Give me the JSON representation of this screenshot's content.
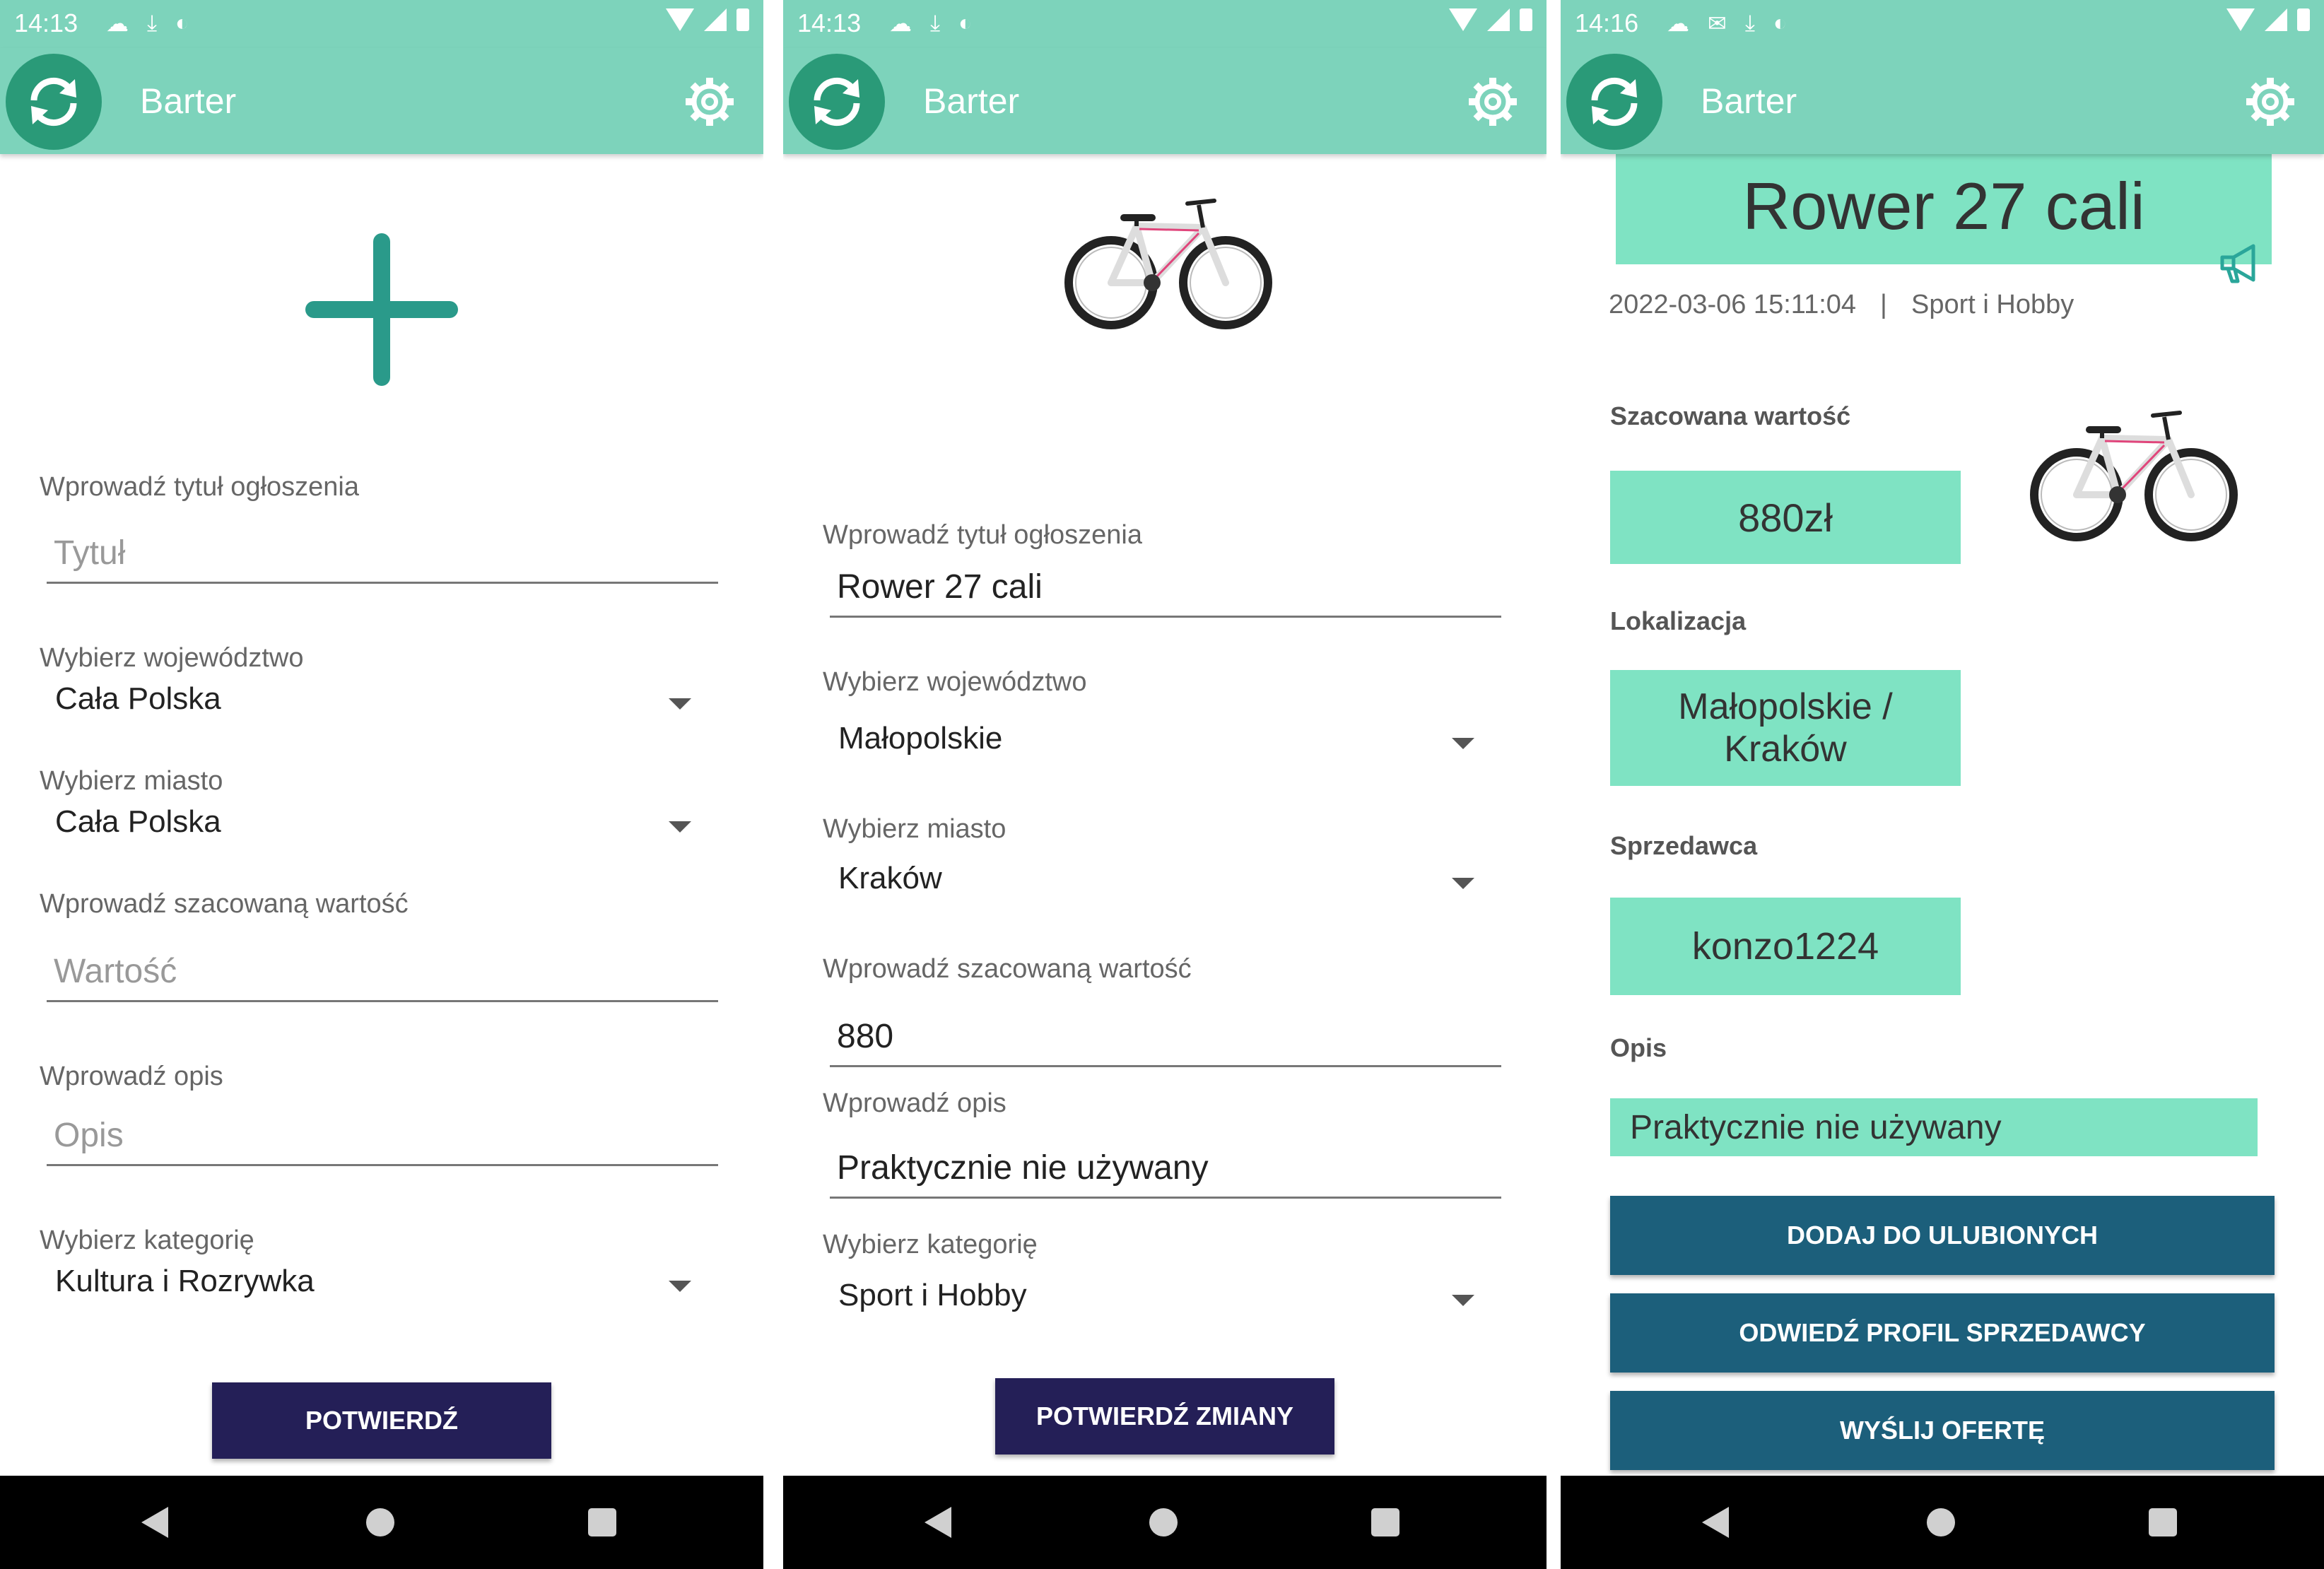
{
  "app": {
    "title": "Barter",
    "accent": "#7dd3bb",
    "logo_color": "#2a9a78"
  },
  "screens": [
    {
      "status": {
        "time": "14:13",
        "icons": [
          "cloud-icon",
          "download-done-icon",
          "pause-circle-icon"
        ]
      },
      "add_image_icon": "plus-icon",
      "title_label": "Wprowadź tytuł ogłoszenia",
      "title_placeholder": "Tytuł",
      "region_label": "Wybierz województwo",
      "region_value": "Cała Polska",
      "city_label": "Wybierz miasto",
      "city_value": "Cała Polska",
      "value_label": "Wprowadź szacowaną wartość",
      "value_placeholder": "Wartość",
      "desc_label": "Wprowadź opis",
      "desc_placeholder": "Opis",
      "category_label": "Wybierz kategorię",
      "category_value": "Kultura i Rozrywka",
      "confirm_button": "POTWIERDŹ"
    },
    {
      "status": {
        "time": "14:13",
        "icons": [
          "cloud-icon",
          "download-done-icon",
          "pause-circle-icon"
        ]
      },
      "title_label": "Wprowadź tytuł ogłoszenia",
      "title_value": "Rower 27 cali",
      "region_label": "Wybierz województwo",
      "region_value": "Małopolskie",
      "city_label": "Wybierz miasto",
      "city_value": "Kraków",
      "value_label": "Wprowadź szacowaną wartość",
      "value_value": "880",
      "desc_label": "Wprowadź opis",
      "desc_value": "Praktycznie nie używany",
      "category_label": "Wybierz kategorię",
      "category_value": "Sport i Hobby",
      "confirm_button": "POTWIERDŹ ZMIANY"
    },
    {
      "status": {
        "time": "14:16",
        "icons": [
          "cloud-icon",
          "mail-icon",
          "download-done-icon",
          "pause-circle-icon"
        ]
      },
      "listing_title": "Rower 27 cali",
      "date": "2022-03-06 15:11:04",
      "separator": "|",
      "category": "Sport i Hobby",
      "value_label": "Szacowana wartość",
      "value": "880zł",
      "location_label": "Lokalizacja",
      "location": "Małopolskie / Kraków",
      "seller_label": "Sprzedawca",
      "seller": "konzo1224",
      "desc_label": "Opis",
      "desc": "Praktycznie nie używany",
      "buttons": [
        "DODAJ DO ULUBIONYCH",
        "ODWIEDŹ PROFIL SPRZEDAWCY",
        "WYŚLIJ OFERTĘ"
      ]
    }
  ]
}
